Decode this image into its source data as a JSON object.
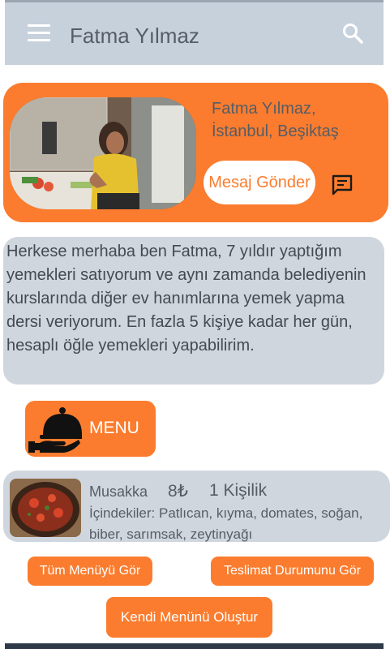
{
  "appbar": {
    "title": "Fatma Yılmaz"
  },
  "profile": {
    "name": "Fatma  Yılmaz,",
    "location": "İstanbul, Beşiktaş",
    "message_button": "Mesaj Gönder"
  },
  "bio": {
    "text": "Herkese merhaba ben Fatma,  7 yıldır yaptığım yemekleri satıyorum ve aynı zamanda belediyenin kurslarında diğer ev hanımlarına yemek yapma dersi veriyorum. En fazla 5 kişiye kadar her gün, hesaplı öğle yemekleri yapabilirim."
  },
  "menu_button": {
    "label": "MENU"
  },
  "menu_item": {
    "name": "Musakka",
    "price": "8₺",
    "portion": "1 Kişilik",
    "ingredients": "İçindekiler:  Patlıcan, kıyma, domates, soğan, biber, sarımsak, zeytinyağı"
  },
  "actions": {
    "all_menu": "Tüm Menüyü Gör",
    "delivery_status": "Teslimat Durumunu Gör",
    "create_menu": "Kendi Menünü Oluştur"
  },
  "icons": {
    "menu": "hamburger-icon",
    "search": "search-icon",
    "chat": "message-icon",
    "menu_button": "serving-cloche-icon"
  },
  "colors": {
    "accent": "#fb7c2e",
    "appbar": "#c7d1dc",
    "panel": "#d0d6de",
    "text": "#555d66"
  }
}
